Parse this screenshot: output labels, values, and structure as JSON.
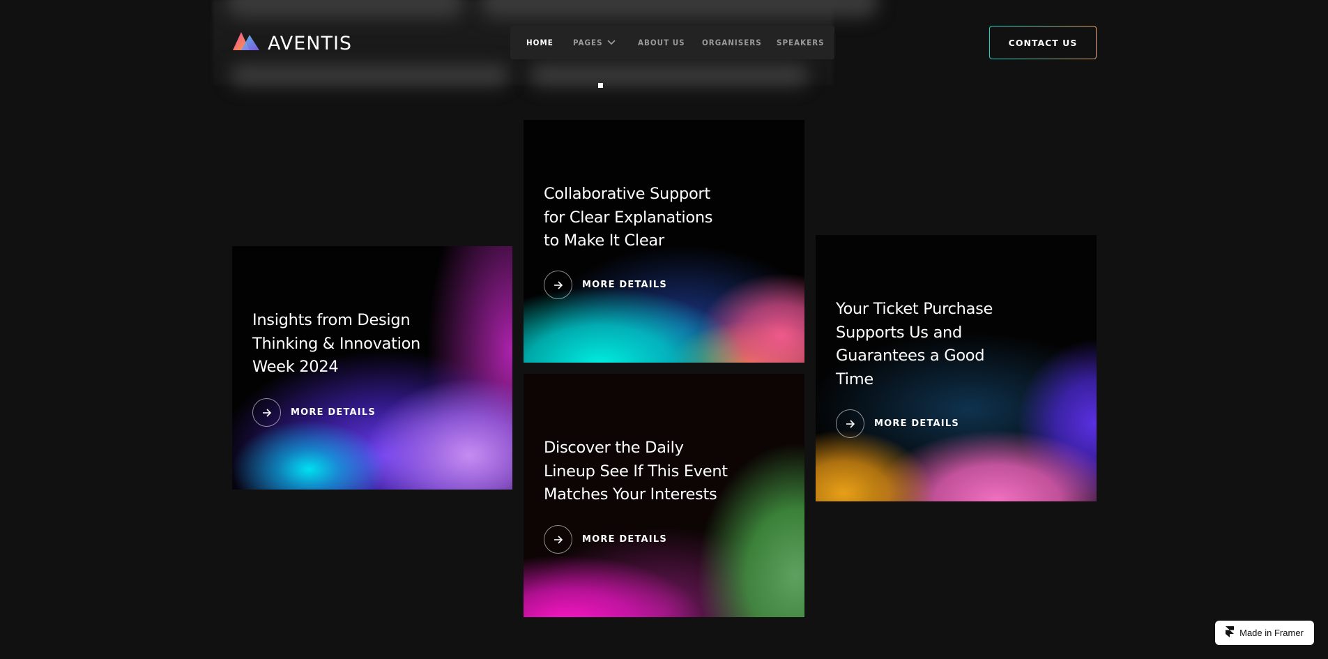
{
  "header": {
    "logo_text": "AVENTIS",
    "nav": [
      {
        "label": "HOME",
        "active": true
      },
      {
        "label": "PAGES",
        "has_dropdown": true
      },
      {
        "label": "ABOUT US"
      },
      {
        "label": "ORGANISERS"
      },
      {
        "label": "SPEAKERS"
      }
    ],
    "contact_label": "CONTACT US"
  },
  "cards": [
    {
      "title_lines": [
        "Insights from Design",
        "Thinking & Innovation",
        "Week 2024"
      ],
      "link_label": "MORE DETAILS"
    },
    {
      "title_lines": [
        "Collaborative Support",
        "for Clear Explanations",
        "to Make It Clear"
      ],
      "link_label": "MORE DETAILS"
    },
    {
      "title_lines": [
        "Discover the Daily",
        "Lineup See If This Event",
        "Matches Your Interests"
      ],
      "link_label": "MORE DETAILS"
    },
    {
      "title_lines": [
        "Your Ticket Purchase",
        "Supports Us and",
        "Guarantees a Good",
        "Time"
      ],
      "link_label": "MORE DETAILS"
    }
  ],
  "badge": {
    "label": "Made in Framer"
  },
  "colors": {
    "background": "#111111",
    "nav_bg": "#232323",
    "accent_teal": "#18d6c8",
    "accent_orange": "#e8a070"
  },
  "icons": {
    "logo": "triangle-logo-icon",
    "dropdown": "chevron-down-icon",
    "link": "arrow-right-icon",
    "framer": "framer-icon"
  }
}
